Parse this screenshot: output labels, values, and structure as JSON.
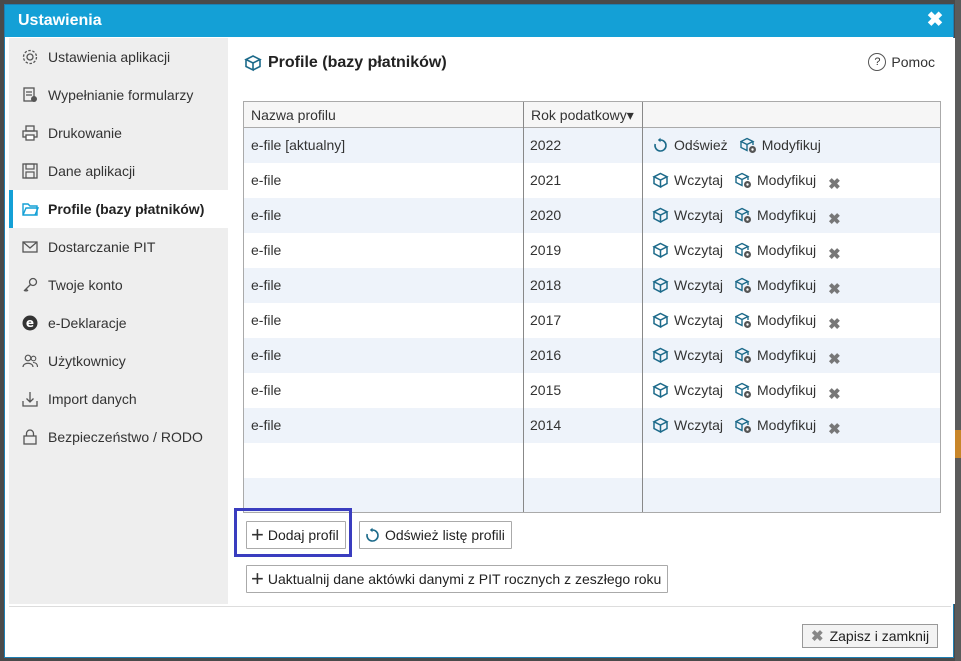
{
  "window": {
    "title": "Ustawienia",
    "close_label": "✖"
  },
  "sidebar": {
    "items": [
      {
        "label": "Ustawienia aplikacji",
        "icon": "gear-icon"
      },
      {
        "label": "Wypełnianie formularzy",
        "icon": "form-icon"
      },
      {
        "label": "Drukowanie",
        "icon": "printer-icon"
      },
      {
        "label": "Dane aplikacji",
        "icon": "save-icon"
      },
      {
        "label": "Profile (bazy płatników)",
        "icon": "folder-icon",
        "active": true
      },
      {
        "label": "Dostarczanie PIT",
        "icon": "envelope-icon"
      },
      {
        "label": "Twoje konto",
        "icon": "key-icon"
      },
      {
        "label": "e-Deklaracje",
        "icon": "e-icon"
      },
      {
        "label": "Użytkownicy",
        "icon": "users-icon"
      },
      {
        "label": "Import danych",
        "icon": "import-icon"
      },
      {
        "label": "Bezpieczeństwo / RODO",
        "icon": "lock-icon"
      }
    ]
  },
  "content": {
    "title": "Profile (bazy płatników)",
    "help_label": "Pomoc",
    "help_glyph": "?",
    "table": {
      "headers": {
        "name": "Nazwa profilu",
        "year": "Rok podatkowy▾"
      },
      "rows": [
        {
          "name": "e-file [aktualny]",
          "year": "2022",
          "a1": "Odśwież",
          "a2": "Modyfikuj",
          "deletable": false
        },
        {
          "name": "e-file",
          "year": "2021",
          "a1": "Wczytaj",
          "a2": "Modyfikuj",
          "deletable": true
        },
        {
          "name": "e-file",
          "year": "2020",
          "a1": "Wczytaj",
          "a2": "Modyfikuj",
          "deletable": true
        },
        {
          "name": "e-file",
          "year": "2019",
          "a1": "Wczytaj",
          "a2": "Modyfikuj",
          "deletable": true
        },
        {
          "name": "e-file",
          "year": "2018",
          "a1": "Wczytaj",
          "a2": "Modyfikuj",
          "deletable": true
        },
        {
          "name": "e-file",
          "year": "2017",
          "a1": "Wczytaj",
          "a2": "Modyfikuj",
          "deletable": true
        },
        {
          "name": "e-file",
          "year": "2016",
          "a1": "Wczytaj",
          "a2": "Modyfikuj",
          "deletable": true
        },
        {
          "name": "e-file",
          "year": "2015",
          "a1": "Wczytaj",
          "a2": "Modyfikuj",
          "deletable": true
        },
        {
          "name": "e-file",
          "year": "2014",
          "a1": "Wczytaj",
          "a2": "Modyfikuj",
          "deletable": true
        }
      ],
      "delete_glyph": "✖"
    },
    "buttons": {
      "add_profile": "Dodaj profil",
      "refresh_list": "Odśwież listę profili",
      "update_briefcase": "Uaktualnij dane aktówki danymi z PIT rocznych z zeszłego roku",
      "plus_glyph": "+"
    }
  },
  "footer": {
    "save_close": "Zapisz i zamknij",
    "save_glyph": "✖"
  },
  "colors": {
    "titlebar": "#14a0d6",
    "focus": "#3a3dbf",
    "alt_row": "#eef3fa"
  }
}
